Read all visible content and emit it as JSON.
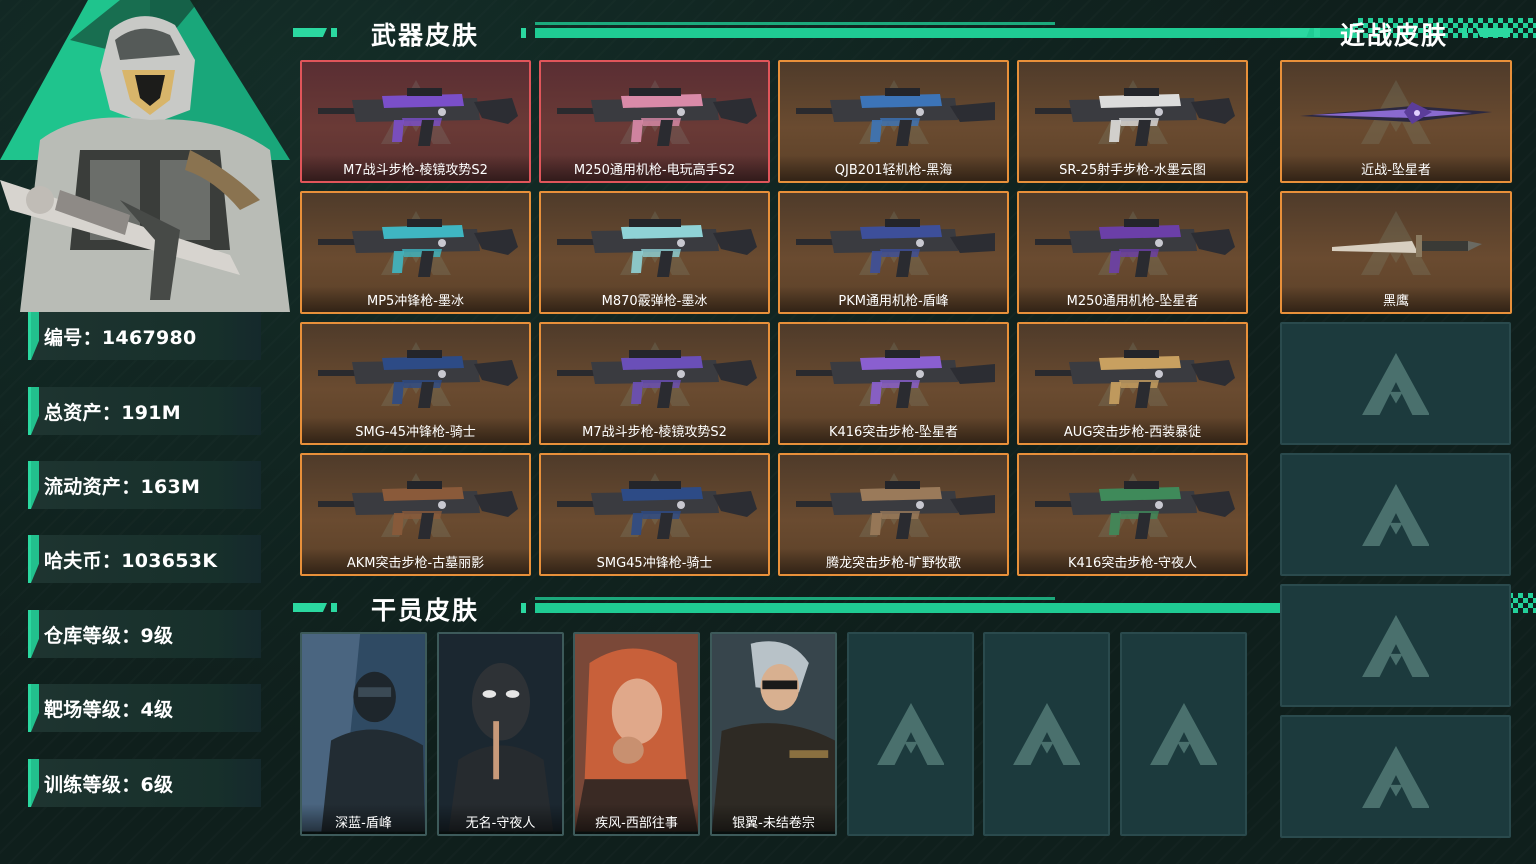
{
  "stats": [
    {
      "label": "编号：",
      "value": "1467980"
    },
    {
      "label": "总资产：",
      "value": "191M"
    },
    {
      "label": "流动资产：",
      "value": "163M"
    },
    {
      "label": "哈夫币：",
      "value": "103653K"
    },
    {
      "label": "仓库等级：",
      "value": "9级"
    },
    {
      "label": "靶场等级：",
      "value": "4级"
    },
    {
      "label": "训练等级：",
      "value": "6级"
    }
  ],
  "stat_lines": [
    "编号：1467980",
    "总资产：191M",
    "流动资产：163M",
    "哈夫币：103653K",
    "仓库等级：9级",
    "靶场等级：4级",
    "训练等级：6级"
  ],
  "sections": {
    "weapons_title": "武器皮肤",
    "melee_title": "近战皮肤",
    "operators_title": "干员皮肤"
  },
  "weapons": [
    {
      "name": "M7战斗步枪-棱镜攻势S2",
      "rarity": "red",
      "accent": "#7a4fc9"
    },
    {
      "name": "M250通用机枪-电玩高手S2",
      "rarity": "red",
      "accent": "#d98aa8"
    },
    {
      "name": "QJB201轻机枪-黑海",
      "rarity": "gold",
      "accent": "#3c74b8"
    },
    {
      "name": "SR-25射手步枪-水墨云图",
      "rarity": "gold",
      "accent": "#dcdcdc"
    },
    {
      "name": "MP5冲锋枪-墨冰",
      "rarity": "gold",
      "accent": "#3fb6c2"
    },
    {
      "name": "M870霰弹枪-墨冰",
      "rarity": "gold",
      "accent": "#8fd2d6"
    },
    {
      "name": "PKM通用机枪-盾峰",
      "rarity": "gold",
      "accent": "#3d4f9a"
    },
    {
      "name": "M250通用机枪-坠星者",
      "rarity": "gold",
      "accent": "#6b3fa8"
    },
    {
      "name": "SMG-45冲锋枪-骑士",
      "rarity": "gold",
      "accent": "#2d4b86"
    },
    {
      "name": "M7战斗步枪-棱镜攻势S2",
      "rarity": "gold",
      "accent": "#6a4fb8"
    },
    {
      "name": "K416突击步枪-坠星者",
      "rarity": "gold",
      "accent": "#8a5fd0"
    },
    {
      "name": "AUG突击步枪-西装暴徒",
      "rarity": "gold",
      "accent": "#c8a060"
    },
    {
      "name": "AKM突击步枪-古墓丽影",
      "rarity": "gold",
      "accent": "#8a5a3a"
    },
    {
      "name": "SMG45冲锋枪-骑士",
      "rarity": "gold",
      "accent": "#2d4b86"
    },
    {
      "name": "腾龙突击步枪-旷野牧歌",
      "rarity": "gold",
      "accent": "#9a7a5a"
    },
    {
      "name": "K416突击步枪-守夜人",
      "rarity": "gold",
      "accent": "#3f8a5a"
    }
  ],
  "melee": [
    {
      "name": "近战-坠星者"
    },
    {
      "name": "黑鹰"
    }
  ],
  "operators": [
    {
      "name": "深蓝-盾峰",
      "bg": "#2f4a63"
    },
    {
      "name": "无名-守夜人",
      "bg": "#1d2a33"
    },
    {
      "name": "疾风-西部往事",
      "bg": "#8a5040"
    },
    {
      "name": "银翼-未结卷宗",
      "bg": "#3c4a50"
    }
  ],
  "colors": {
    "accent_green": "#2bd8a0",
    "gold_border": "#e8903a",
    "red_border": "#e0555a",
    "empty_slot": "#1c3a3d"
  }
}
